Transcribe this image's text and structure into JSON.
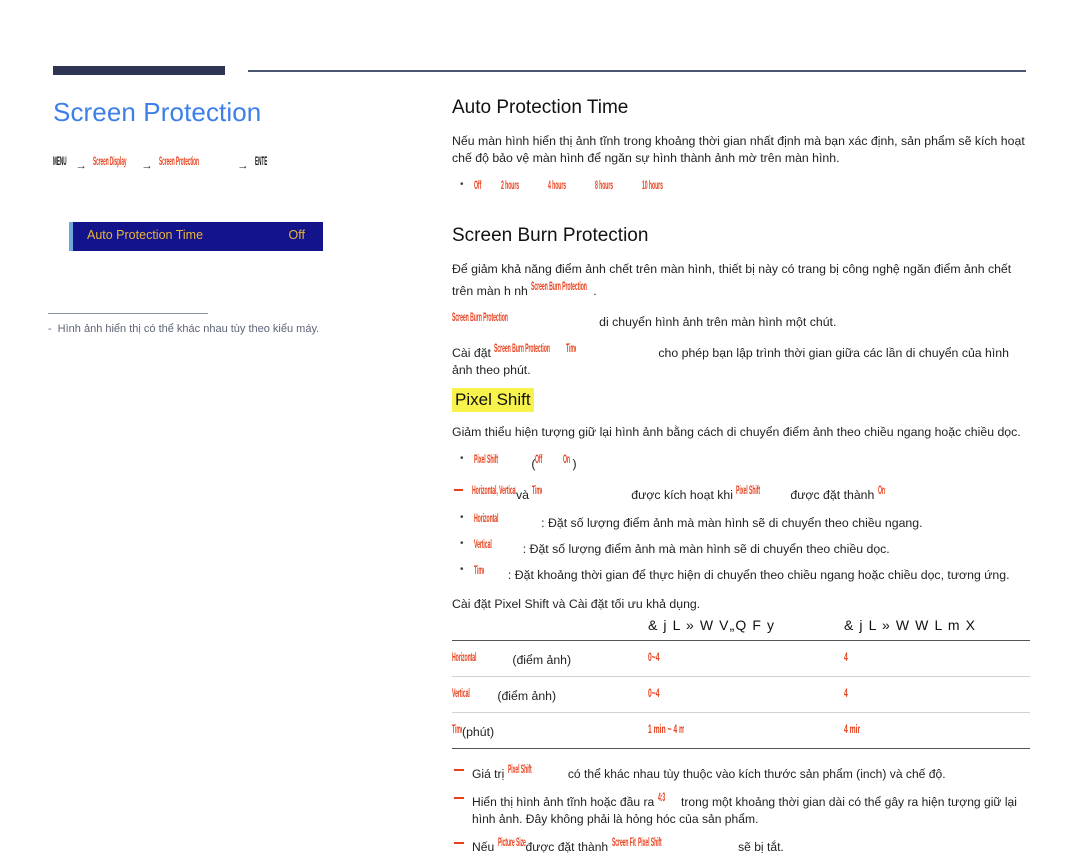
{
  "left": {
    "title": "Screen Protection",
    "breadcrumb": {
      "menu": "MENU",
      "screen_display": "Screen Display",
      "screen_protection": "Screen Protection",
      "enter": "ENTER",
      "arrow": "→"
    },
    "osd": {
      "label": "Auto Protection Time",
      "value": "Off"
    },
    "note_dash": "-",
    "note": "Hình ảnh hiển thị có thể khác nhau tùy theo kiểu máy."
  },
  "right": {
    "auto_protection": {
      "heading": "Auto Protection Time",
      "paragraph": "Nếu màn hình hiển thị ảnh tĩnh trong khoảng thời gian nhất định mà bạn xác định, sản phẩm sẽ kích hoạt chế độ bảo vệ màn hình để ngăn sự hình thành ảnh mờ trên màn hình.",
      "options": [
        "Off",
        "2 hours",
        "4 hours",
        "8 hours",
        "10 hours"
      ]
    },
    "burn_protection": {
      "heading": "Screen Burn Protection",
      "p1_before": "Để giảm khả năng điểm ảnh chết trên màn hình, thiết bị này có trang bị công nghệ ngăn điểm ảnh chết trên màn h nh ",
      "p1_term": "Screen Burn Protection",
      "p1_after": ".",
      "p2_term": "Screen Burn Protection",
      "p2_after": "di chuyển hình ảnh trên màn hình một chút.",
      "p3_before": "Cài đặt ",
      "p3_term": "Screen Burn Protection",
      "p3_term2": "Time",
      "p3_after": "cho phép bạn lập trình thời gian giữa các lần di chuyển của hình ảnh theo phút."
    },
    "pixel_shift": {
      "heading": "Pixel Shift",
      "paragraph": "Giảm thiểu hiện tượng giữ lại hình ảnh bằng cách di chuyển điểm ảnh theo chiều ngang hoặc chiều dọc.",
      "bullet_term": "Pixel Shift",
      "bullet_paren_open": "(",
      "bullet_off": "Off",
      "bullet_slash": "/",
      "bullet_on": "On",
      "bullet_paren_close": ")",
      "subnote_terms": "Horizontal, Vertical",
      "subnote_and": "và",
      "subnote_time": "Time",
      "subnote_mid": "được kích hoạt khi",
      "subnote_term2": "Pixel Shift",
      "subnote_tail": "được đặt thành",
      "subnote_on": "On",
      "items": [
        {
          "term": "Horizontal",
          "desc": ": Đặt số lượng điểm ảnh mà màn hình sẽ di chuyển theo chiều ngang."
        },
        {
          "term": "Vertical",
          "desc": ": Đặt số lượng điểm ảnh mà màn hình sẽ di chuyển theo chiều dọc."
        },
        {
          "term": "Time",
          "desc": ": Đặt khoảng thời gian để thực hiện di chuyển theo chiều ngang hoặc chiều dọc, tương ứng."
        }
      ]
    },
    "table": {
      "caption": "Cài đặt Pixel Shift và Cài đặt tối ưu khả dụng.",
      "headers": [
        "",
        "& j L  » W  V„Q  F y",
        "& j L  » W  W  L  m X"
      ],
      "rows": [
        {
          "term": "Horizontal",
          "unit": "(điểm ảnh)",
          "v1": "0~4",
          "v2": "4"
        },
        {
          "term": "Vertical",
          "unit": "(điểm ảnh)",
          "v1": "0~4",
          "v2": "4"
        },
        {
          "term": "Time",
          "unit": "(phút)",
          "v1": "1 min ~ 4 min",
          "v2": "4 min"
        }
      ]
    },
    "footnotes": [
      {
        "before": "Giá trị ",
        "term": "Pixel Shift",
        "after": "có thể khác nhau tùy thuộc vào kích thước sản phẩm (inch) và chế độ."
      },
      {
        "before": "Hiển thị hình ảnh tĩnh hoặc đầu ra ",
        "term": "4:3",
        "after": "trong một khoảng thời gian dài có thể gây ra hiện tượng giữ lại hình ảnh. Đây không phải là hỏng hóc của sản phẩm."
      },
      {
        "before": "Nếu ",
        "term": "Picture Size",
        "mid": "được đặt thành ",
        "term2": "Screen Fit",
        "term3": "Pixel Shift",
        "after": "sẽ bị tắt."
      }
    ]
  },
  "colors": {
    "title": "#3d7fe8",
    "rule_dark": "#2e3552",
    "ui_term": "#e8401c",
    "osd_bg": "#13138c",
    "osd_text": "#e8b33a",
    "highlight": "#f7f24c"
  }
}
